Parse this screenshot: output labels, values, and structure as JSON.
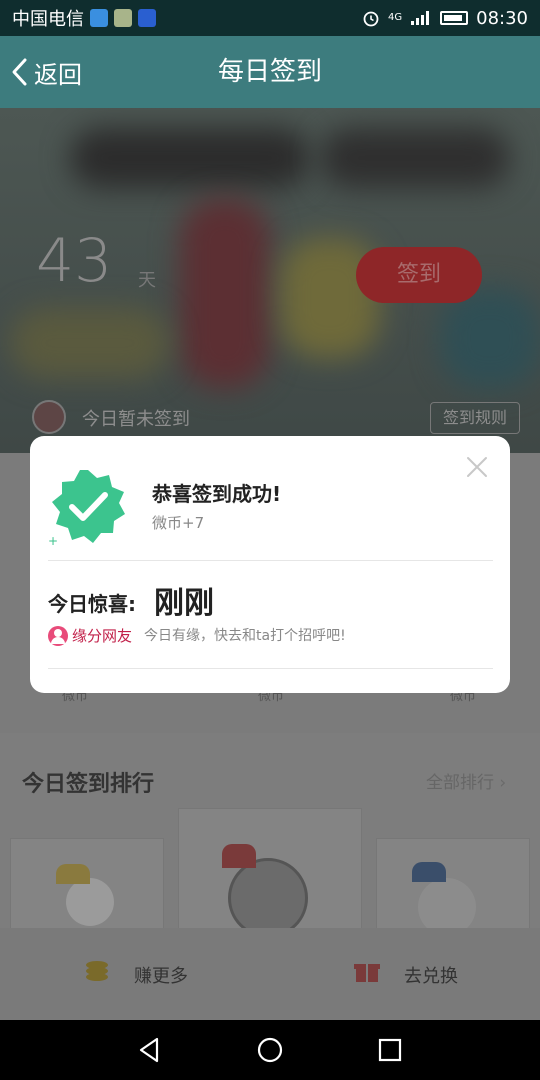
{
  "status_bar": {
    "carrier": "中国电信",
    "network": "4G",
    "time": "08:30"
  },
  "nav": {
    "back_label": "返回",
    "title": "每日签到"
  },
  "background": {
    "days_count": "43",
    "days_unit": "天",
    "sign_button": "签到",
    "unsigned_text": "今日暂未签到",
    "rules_button": "签到规则",
    "coin_labels": [
      "微币",
      "微币",
      "微币"
    ],
    "ranking_title": "今日签到排行",
    "ranking_all": "全部排行",
    "earn_more": "赚更多",
    "exchange": "去兑换"
  },
  "modal": {
    "title": "恭喜签到成功!",
    "reward": "微币+7",
    "surprise_label": "今日惊喜:",
    "surprise_value": "刚刚",
    "tag_label": "缘分网友",
    "tag_text": "今日有缘，快去和ta打个招呼吧!"
  },
  "colors": {
    "nav_bg": "#3d7c7e",
    "badge_green": "#3cc48e",
    "tag_pink": "#e84b7a",
    "tag_text": "#c2214a"
  }
}
